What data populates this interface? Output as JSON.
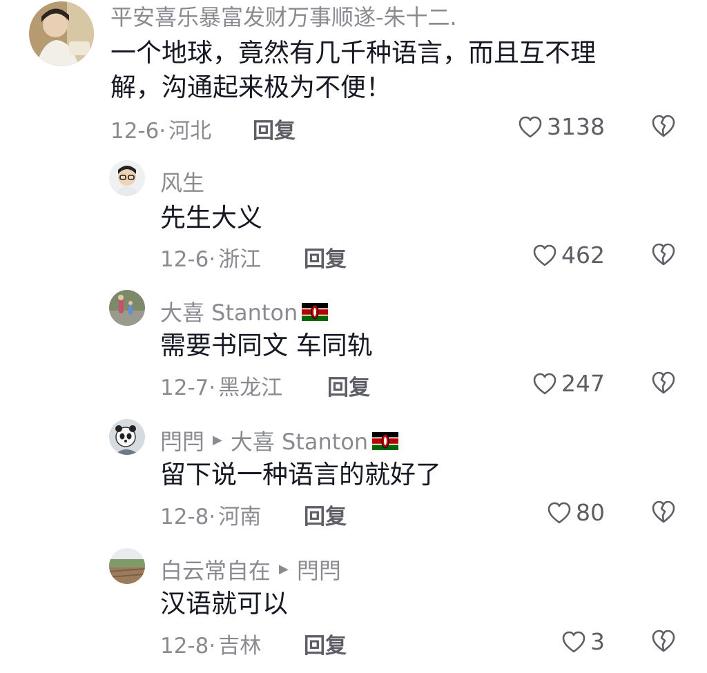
{
  "comments": [
    {
      "username": "平安喜乐暴富发财万事顺遂-朱十二.",
      "text_lines": [
        "一个地球，竟然有几千种语言，而且互不理",
        "解，沟通起来极为不便！"
      ],
      "date": "12-6",
      "location": "河北",
      "reply_label": "回复",
      "likes": "3138"
    },
    {
      "username": "风生",
      "text": "先生大义",
      "date": "12-6",
      "location": "浙江",
      "reply_label": "回复",
      "likes": "462"
    },
    {
      "username": "大喜 Stanton",
      "flag_icon": "kenya-flag-icon",
      "text": "需要书同文 车同轨",
      "date": "12-7",
      "location": "黑龙江",
      "reply_label": "回复",
      "likes": "247"
    },
    {
      "username": "閂閂",
      "reply_to": "大喜 Stanton",
      "flag_icon": "kenya-flag-icon",
      "text": "留下说一种语言的就好了",
      "date": "12-8",
      "location": "河南",
      "reply_label": "回复",
      "likes": "80"
    },
    {
      "username": "白云常自在",
      "reply_to": "閂閂",
      "text": "汉语就可以",
      "date": "12-8",
      "location": "吉林",
      "reply_label": "回复",
      "likes": "3"
    }
  ],
  "separator": "·",
  "icons": {
    "like": "heart-outline-icon",
    "dislike": "broken-heart-icon",
    "reply_arrow": "triangle-right-icon"
  },
  "colors": {
    "text": "#161823",
    "meta": "#8a8b91",
    "action": "#5d5e66"
  }
}
